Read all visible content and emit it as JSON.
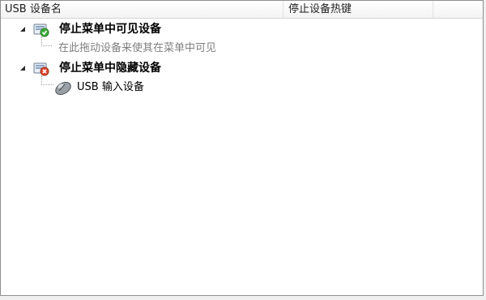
{
  "columns": {
    "name": "USB 设备名",
    "hotkey": "停止设备热键",
    "extra": ""
  },
  "tree": {
    "group_visible": {
      "label": "停止菜单中可见设备",
      "icon": "usb-hub-green-check-icon",
      "hint": "在此拖动设备来使其在菜单中可见"
    },
    "group_hidden": {
      "label": "停止菜单中隐藏设备",
      "icon": "usb-hub-red-x-icon",
      "device": {
        "label": "USB 输入设备",
        "icon": "mouse-icon"
      }
    }
  }
}
